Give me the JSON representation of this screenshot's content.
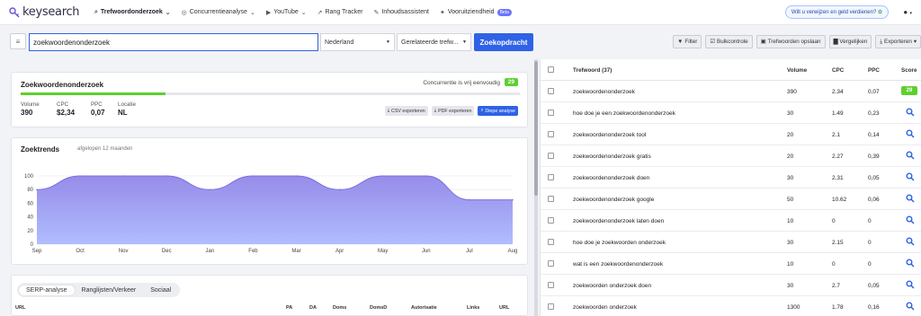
{
  "app": {
    "logo_text": "keysearch",
    "nav": [
      {
        "label": "Trefwoordonderzoek",
        "icon": "search-icon",
        "dropdown": true,
        "active": true
      },
      {
        "label": "Concurrentieanalyse",
        "icon": "compass-icon",
        "dropdown": true
      },
      {
        "label": "YouTube",
        "icon": "play-icon",
        "dropdown": true
      },
      {
        "label": "Rang Tracker",
        "icon": "chart-line-icon",
        "dropdown": false
      },
      {
        "label": "Inhoudsassistent",
        "icon": "pen-icon",
        "dropdown": false
      },
      {
        "label": "Vooruitziendheid",
        "icon": "telescope-icon",
        "dropdown": false,
        "badge": "Beta"
      }
    ],
    "promo": "Wilt u verwijzen en geld verdienen?",
    "user_icon": "user-icon"
  },
  "search": {
    "keyword": "zoekwoordenonderzoek",
    "country": "Nederland",
    "mode": "Gerelateerde trefw...",
    "submit": "Zoekopdracht",
    "tools": [
      {
        "label": "Filter",
        "icon": "filter-icon"
      },
      {
        "label": "Bulkcontrole",
        "icon": "list-check-icon"
      },
      {
        "label": "Trefwoorden opslaan",
        "icon": "save-icon"
      },
      {
        "label": "Vergelijken",
        "icon": "bar-chart-icon"
      },
      {
        "label": "Exporteren",
        "icon": "download-icon",
        "dropdown": true
      }
    ]
  },
  "overview": {
    "title": "Zoekwoordenonderzoek",
    "competition_text": "Concurrentie is vrij eenvoudig",
    "score": "29",
    "progress": 0.29,
    "metrics": [
      {
        "label": "Volume",
        "value": "390"
      },
      {
        "label": "CPC",
        "value": "$2,34"
      },
      {
        "label": "PPC",
        "value": "0,07"
      },
      {
        "label": "Locatie",
        "value": "NL"
      }
    ],
    "buttons": [
      {
        "label": "CSV exporteren",
        "icon": "download-icon"
      },
      {
        "label": "PDF exporteren",
        "icon": "download-icon"
      },
      {
        "label": "Diepe analyse",
        "icon": "search-icon"
      }
    ]
  },
  "trends": {
    "title": "Zoektrends",
    "subtitle": "afgelopen 12 maanden"
  },
  "chart_data": {
    "type": "area",
    "title": "Zoektrends",
    "categories": [
      "Sep",
      "Oct",
      "Nov",
      "Dec",
      "Jan",
      "Feb",
      "Mar",
      "Apr",
      "May",
      "Jun",
      "Jul",
      "Aug"
    ],
    "series": [
      {
        "values": [
          80,
          100,
          100,
          100,
          80,
          100,
          100,
          80,
          100,
          100,
          65,
          65
        ]
      }
    ],
    "ylim": [
      0,
      100
    ],
    "yticks": [
      0,
      20,
      40,
      60,
      80,
      100
    ],
    "grid": true,
    "colors": {
      "top": "#8b7fe6",
      "bottom": "#a7b6ff",
      "line": "#7b6ee0"
    }
  },
  "serp": {
    "tabs": [
      "SERP-analyse",
      "Ranglijsten/Verkeer",
      "Sociaal"
    ],
    "columns": [
      "URL",
      "PA",
      "DA",
      "Doms",
      "DomsD",
      "Autorisatie",
      "Links",
      "URL"
    ]
  },
  "keywords": {
    "columns": [
      "Trefwoord (37)",
      "Volume",
      "CPC",
      "PPC",
      "Score"
    ],
    "rows": [
      {
        "kw": "zoekwoordenonderzoek",
        "volume": "390",
        "cpc": "2.34",
        "ppc": "0,07",
        "score": "29"
      },
      {
        "kw": "hoe doe je een zoekwoordenonderzoek",
        "volume": "30",
        "cpc": "1.49",
        "ppc": "0,23",
        "score": ""
      },
      {
        "kw": "zoekwoordenonderzoek tool",
        "volume": "20",
        "cpc": "2.1",
        "ppc": "0,14",
        "score": ""
      },
      {
        "kw": "zoekwoordenonderzoek gratis",
        "volume": "20",
        "cpc": "2.27",
        "ppc": "0,39",
        "score": ""
      },
      {
        "kw": "zoekwoordenonderzoek doen",
        "volume": "30",
        "cpc": "2.31",
        "ppc": "0,05",
        "score": ""
      },
      {
        "kw": "zoekwoordenonderzoek google",
        "volume": "50",
        "cpc": "10.62",
        "ppc": "0,06",
        "score": ""
      },
      {
        "kw": "zoekwoordenonderzoek laten doen",
        "volume": "10",
        "cpc": "0",
        "ppc": "0",
        "score": ""
      },
      {
        "kw": "hoe doe je zoekwoorden onderzoek",
        "volume": "30",
        "cpc": "2.15",
        "ppc": "0",
        "score": ""
      },
      {
        "kw": "wat is een zoekwoordenonderzoek",
        "volume": "10",
        "cpc": "0",
        "ppc": "0",
        "score": ""
      },
      {
        "kw": "zoekwoorden onderzoek doen",
        "volume": "30",
        "cpc": "2.7",
        "ppc": "0,05",
        "score": ""
      },
      {
        "kw": "zoekwoorden onderzoek",
        "volume": "1300",
        "cpc": "1.78",
        "ppc": "0,16",
        "score": ""
      }
    ]
  }
}
